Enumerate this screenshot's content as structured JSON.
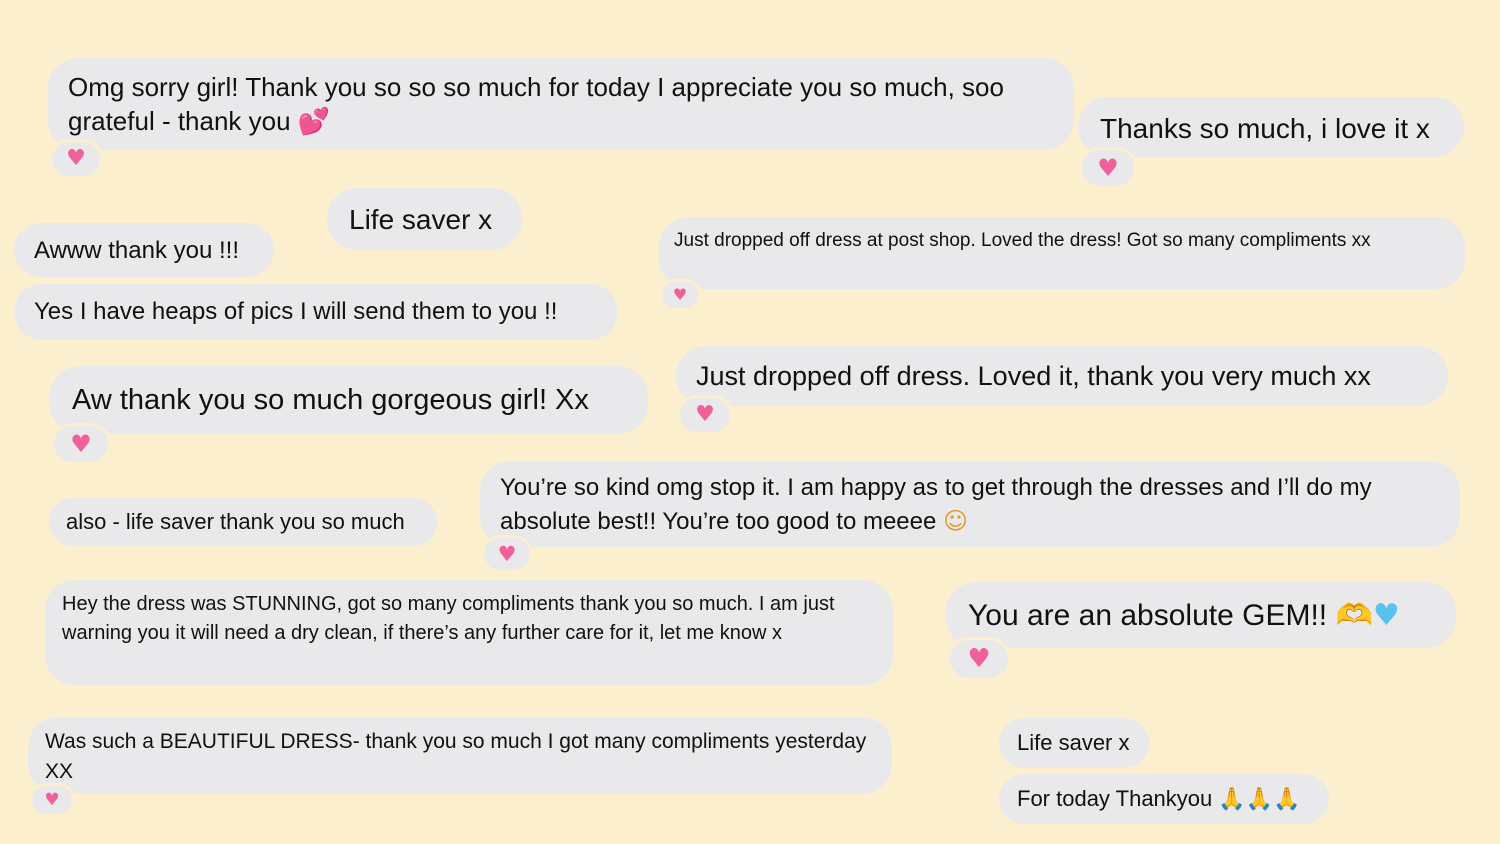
{
  "messages": {
    "m1": {
      "text": "Omg sorry girl! Thank you so so so much for today I appreciate you so much, soo grateful - thank you",
      "emoji": "💕"
    },
    "m2": {
      "text": "Thanks so much, i love it x"
    },
    "m3": {
      "text": "Life saver x"
    },
    "m4": {
      "text": "Awww thank you !!!"
    },
    "m5": {
      "text": "Just dropped off dress at post shop. Loved the dress! Got so many compliments xx"
    },
    "m6": {
      "text": "Yes I have heaps of pics I will send them to you !!"
    },
    "m7": {
      "text": "Aw thank you so much gorgeous girl! Xx"
    },
    "m8": {
      "text": "Just dropped off dress. Loved it, thank you very much xx"
    },
    "m9": {
      "text": "also - life saver thank you so much"
    },
    "m10": {
      "text": "You’re so kind omg stop it. I am happy as to get through the dresses and I’ll do my absolute best!! You’re too good to meeee",
      "emoji1": "☺",
      "emoji2": "♡"
    },
    "m11": {
      "text": "Hey the dress was STUNNING, got so many compliments thank you so much. I am just warning you it will need a dry clean, if there’s any further care for it, let me know x"
    },
    "m12": {
      "text": "You are an absolute GEM!!",
      "emoji1": "🫶",
      "emoji2": "♥"
    },
    "m13": {
      "text": "Was such a BEAUTIFUL DRESS- thank you so much I got many compliments yesterday XX"
    },
    "m14": {
      "text": "Life saver x"
    },
    "m15": {
      "text": "For today Thankyou",
      "emoji": "🙏🙏🙏"
    }
  },
  "reaction_emoji": "♥",
  "colors": {
    "background": "#fbefcd",
    "bubble": "#e9e9eb",
    "heart": "#f0619c"
  }
}
